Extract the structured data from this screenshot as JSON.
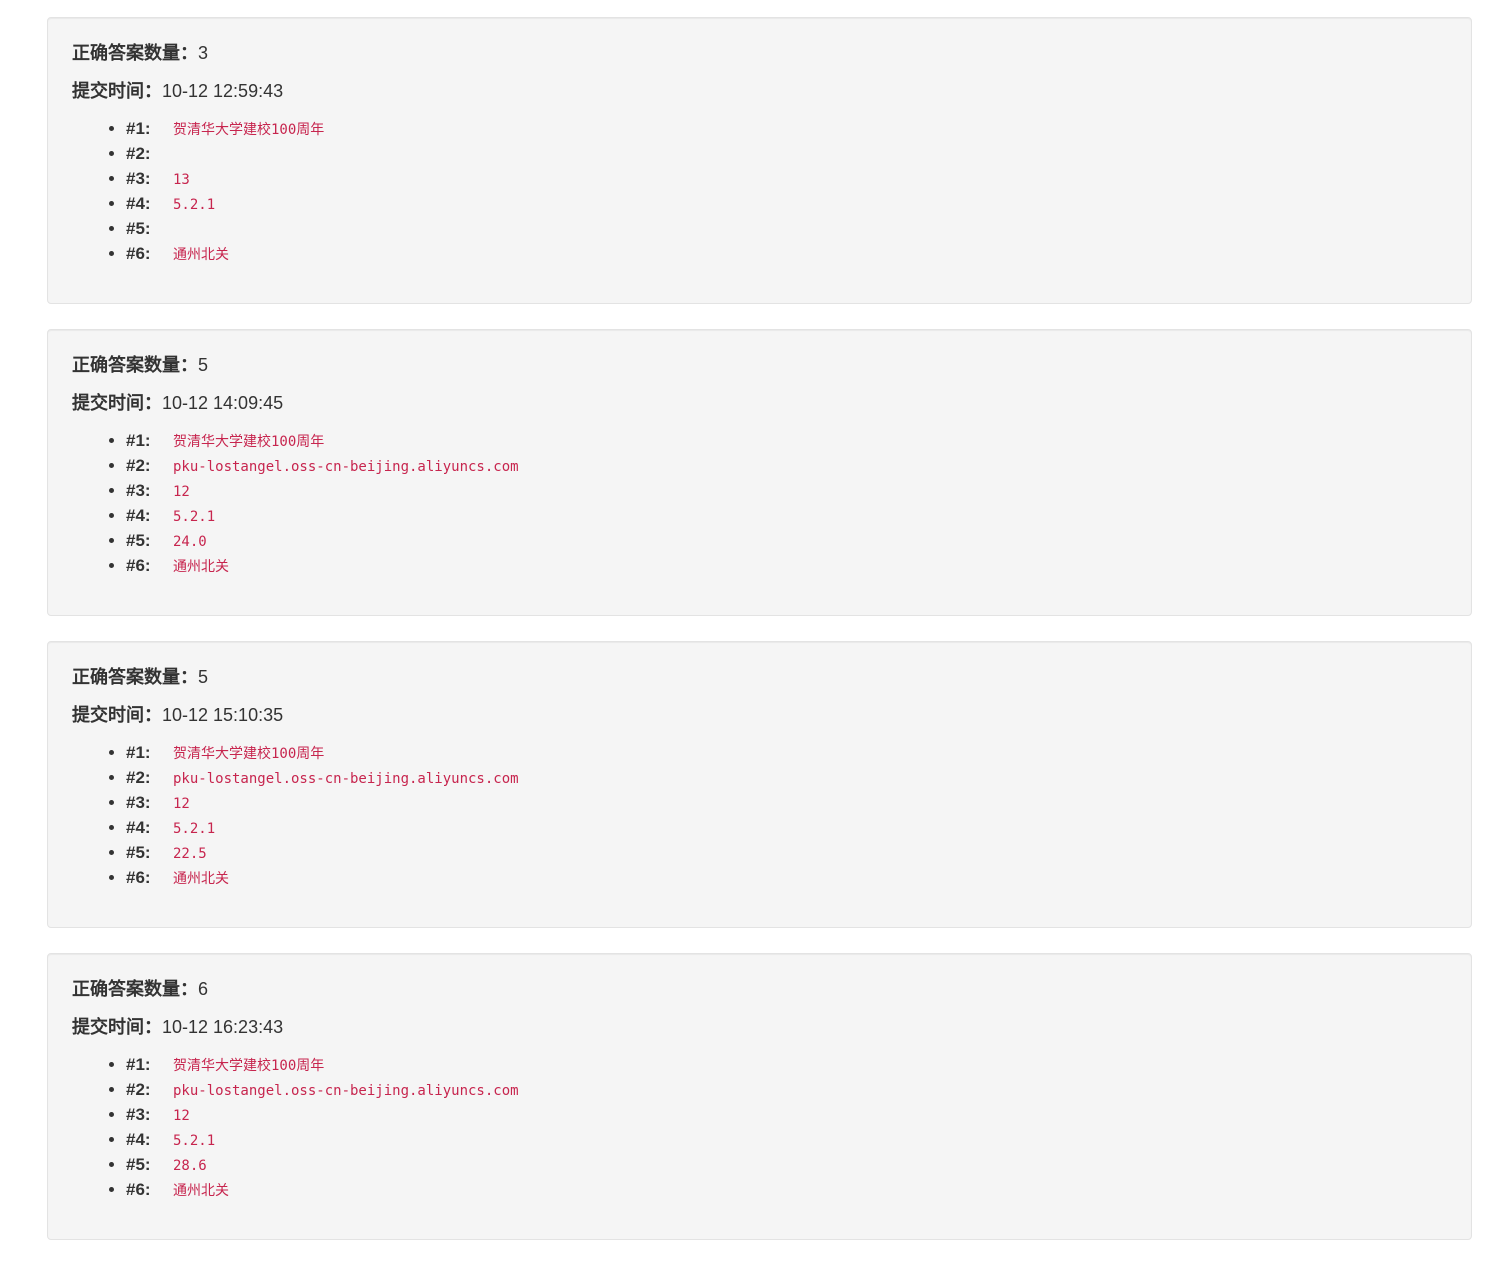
{
  "labels": {
    "correct_count": "正确答案数量：",
    "submit_time": "提交时间："
  },
  "submissions": [
    {
      "correct_count": "3",
      "submit_time": "10-12 12:59:43",
      "answers": [
        {
          "num": "#1:",
          "value": "贺清华大学建校100周年"
        },
        {
          "num": "#2:",
          "value": ""
        },
        {
          "num": "#3:",
          "value": "13"
        },
        {
          "num": "#4:",
          "value": "5.2.1"
        },
        {
          "num": "#5:",
          "value": ""
        },
        {
          "num": "#6:",
          "value": "通州北关"
        }
      ]
    },
    {
      "correct_count": "5",
      "submit_time": "10-12 14:09:45",
      "answers": [
        {
          "num": "#1:",
          "value": "贺清华大学建校100周年"
        },
        {
          "num": "#2:",
          "value": "pku-lostangel.oss-cn-beijing.aliyuncs.com"
        },
        {
          "num": "#3:",
          "value": "12"
        },
        {
          "num": "#4:",
          "value": "5.2.1"
        },
        {
          "num": "#5:",
          "value": "24.0"
        },
        {
          "num": "#6:",
          "value": "通州北关"
        }
      ]
    },
    {
      "correct_count": "5",
      "submit_time": "10-12 15:10:35",
      "answers": [
        {
          "num": "#1:",
          "value": "贺清华大学建校100周年"
        },
        {
          "num": "#2:",
          "value": "pku-lostangel.oss-cn-beijing.aliyuncs.com"
        },
        {
          "num": "#3:",
          "value": "12"
        },
        {
          "num": "#4:",
          "value": "5.2.1"
        },
        {
          "num": "#5:",
          "value": "22.5"
        },
        {
          "num": "#6:",
          "value": "通州北关"
        }
      ]
    },
    {
      "correct_count": "6",
      "submit_time": "10-12 16:23:43",
      "answers": [
        {
          "num": "#1:",
          "value": "贺清华大学建校100周年"
        },
        {
          "num": "#2:",
          "value": "pku-lostangel.oss-cn-beijing.aliyuncs.com"
        },
        {
          "num": "#3:",
          "value": "12"
        },
        {
          "num": "#4:",
          "value": "5.2.1"
        },
        {
          "num": "#5:",
          "value": "28.6"
        },
        {
          "num": "#6:",
          "value": "通州北关"
        }
      ]
    }
  ],
  "colors": {
    "answer_text": "#c7254e",
    "card_background": "#f5f5f5",
    "card_border": "#e3e3e3",
    "body_text": "#333333"
  }
}
